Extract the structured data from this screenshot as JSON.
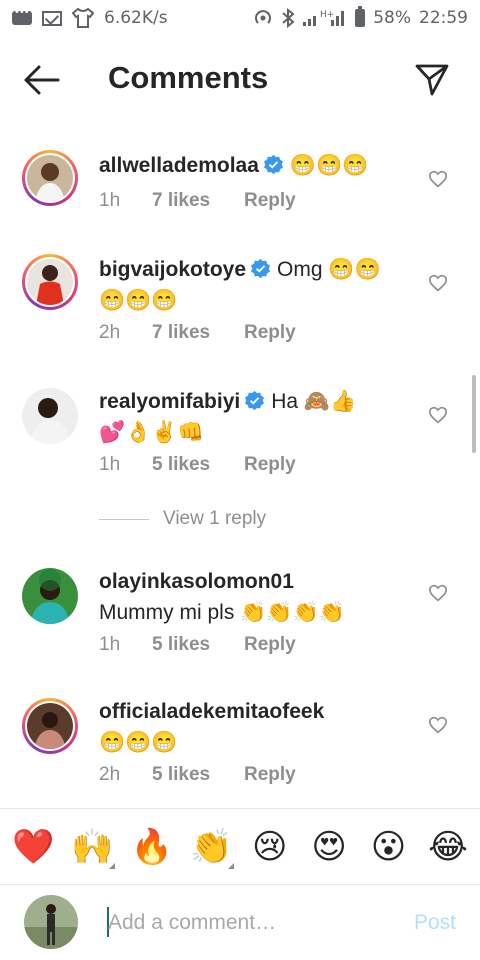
{
  "status_bar": {
    "speed": "6.62K/s",
    "network": "H+",
    "battery": "58%",
    "time": "22:59",
    "icons": [
      "message-icon",
      "gmail-icon",
      "shirt-icon",
      "hotspot-icon",
      "bluetooth-icon",
      "signal-icon",
      "battery-icon"
    ]
  },
  "header": {
    "title": "Comments",
    "back_icon": "arrow-left-icon",
    "share_icon": "direct-send-icon"
  },
  "comments": [
    {
      "username": "allwellademolaa",
      "verified": true,
      "text": "😁😁😁",
      "time": "1h",
      "likes": "7 likes",
      "reply": "Reply"
    },
    {
      "username": "bigvaijokotoye",
      "verified": true,
      "text": "Omg 😁😁",
      "text2": "😁😁😁",
      "time": "2h",
      "likes": "7 likes",
      "reply": "Reply"
    },
    {
      "username": "realyomifabiyi",
      "verified": true,
      "text": "Ha 🙈👍",
      "text2": "💕👌✌️👊",
      "time": "1h",
      "likes": "5 likes",
      "reply": "Reply"
    },
    {
      "username": "olayinkasolomon01",
      "verified": false,
      "text": "Mummy mi pls 👏👏👏👏",
      "time": "1h",
      "likes": "5 likes",
      "reply": "Reply"
    },
    {
      "username": "officialadekemitaofeek",
      "verified": false,
      "text": "😁😁😁",
      "time": "2h",
      "likes": "5 likes",
      "reply": "Reply"
    }
  ],
  "view_replies": "View 1 reply",
  "emoji_bar": [
    "❤️",
    "🙌",
    "🔥",
    "👏",
    "😢",
    "😍",
    "😮",
    "😂"
  ],
  "input": {
    "placeholder": "Add a comment…",
    "post_label": "Post"
  },
  "colors": {
    "verified": "#3897f0",
    "muted": "#8e8e8e",
    "post_disabled": "#b2dffc",
    "story_ring": "#c13584"
  }
}
